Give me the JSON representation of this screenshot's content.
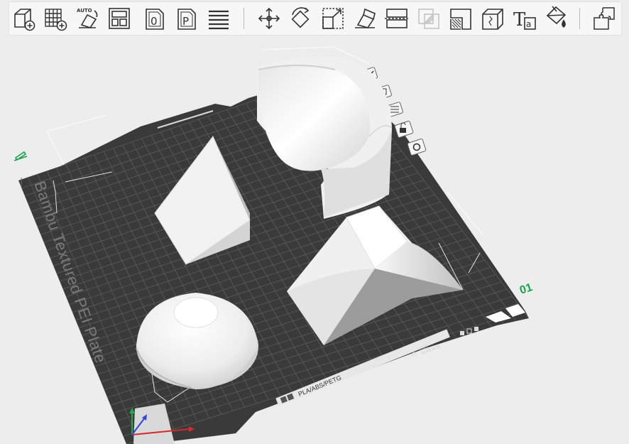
{
  "toolbar": {
    "items": [
      {
        "name": "add-object-icon"
      },
      {
        "name": "add-plate-icon"
      },
      {
        "name": "auto-orient-icon",
        "label": "AUTO"
      },
      {
        "name": "arrange-icon"
      },
      {
        "name": "slice-icon",
        "label": "0"
      },
      {
        "name": "plate-settings-icon",
        "label": "P"
      },
      {
        "name": "layers-icon"
      },
      {
        "name": "move-icon"
      },
      {
        "name": "rotate-icon"
      },
      {
        "name": "scale-icon"
      },
      {
        "name": "lay-on-face-icon"
      },
      {
        "name": "cut-icon"
      },
      {
        "name": "mesh-boolean-icon"
      },
      {
        "name": "support-paint-icon"
      },
      {
        "name": "seam-paint-icon"
      },
      {
        "name": "text-tool-icon",
        "label": "T",
        "sublabel": "a"
      },
      {
        "name": "color-paint-icon"
      },
      {
        "name": "assembly-icon"
      }
    ]
  },
  "plate": {
    "name": "Bambu Textured PEI Plate",
    "filament_label": "PLA/ABS/PETG",
    "hot_label_1": "HOT",
    "hot_label_2": "SURFACE",
    "plate_number": "01"
  },
  "colors": {
    "plate": "#3a3a3a",
    "grid": "#5c5c5c",
    "plate_number": "#17a34a",
    "model": "#f4f4f4"
  }
}
